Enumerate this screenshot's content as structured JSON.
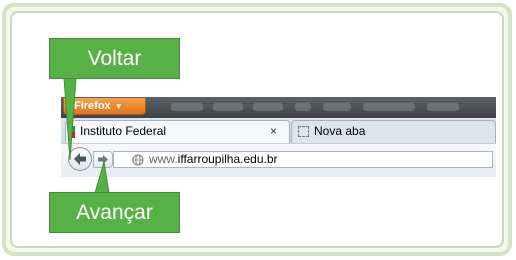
{
  "colors": {
    "callout_green": "#58b146",
    "frame_green": "#d4e3c2",
    "firefox_orange": "#e0741c"
  },
  "callouts": {
    "back": "Voltar",
    "forward": "Avançar"
  },
  "browser": {
    "app_menu_label": "Firefox",
    "tabs": [
      {
        "title": "Instituto Federal",
        "close_glyph": "×",
        "active": true,
        "icon": "site-favicon"
      },
      {
        "title": "Nova aba",
        "active": false,
        "icon": "blank-page-icon"
      }
    ],
    "nav": {
      "back_icon": "back-arrow-icon",
      "forward_icon": "forward-arrow-icon"
    },
    "url": {
      "prefix": "www.",
      "domain": "iffarroupilha.edu.br",
      "icon": "globe-icon"
    }
  }
}
